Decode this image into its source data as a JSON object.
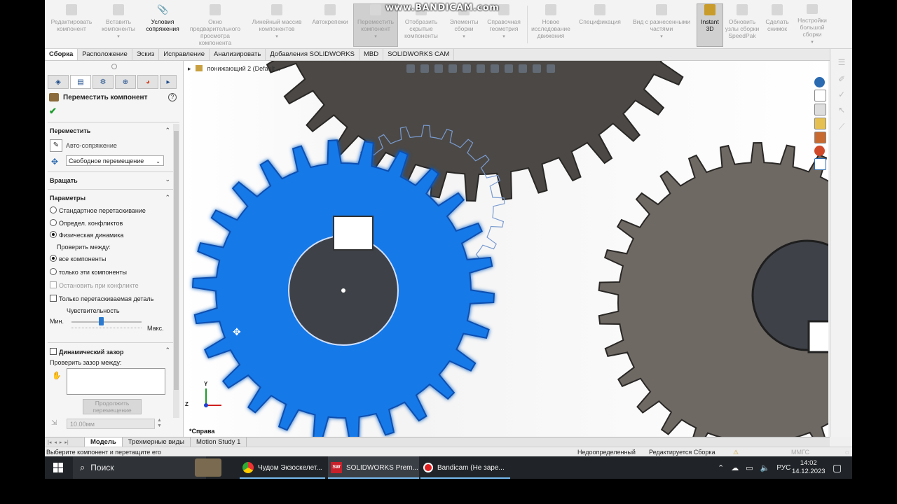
{
  "watermark": "www.BANDICAM.com",
  "ribbon": [
    {
      "id": "edit-component",
      "label": "Редактировать компонент",
      "icon": "edit-component-icon",
      "state": "disabled"
    },
    {
      "id": "insert-components",
      "label": "Вставить компоненты",
      "icon": "insert-components-icon",
      "state": "disabled",
      "dropdown": "▾"
    },
    {
      "id": "mate",
      "label": "Условия сопряжения",
      "icon": "paperclip-icon",
      "state": "active"
    },
    {
      "id": "component-preview",
      "label": "Окно предварительного просмотра компонента",
      "icon": "preview-window-icon",
      "state": "disabled"
    },
    {
      "id": "linear-pattern",
      "label": "Линейный массив компонентов",
      "icon": "linear-pattern-icon",
      "state": "disabled",
      "dropdown": "▾"
    },
    {
      "id": "smart-fasteners",
      "label": "Автокрепежи",
      "icon": "fasteners-icon",
      "state": "disabled"
    },
    {
      "id": "move-component",
      "label": "Переместить компонент",
      "icon": "move-component-icon",
      "state": "pressed",
      "dropdown": "▾"
    },
    {
      "id": "show-hidden",
      "label": "Отобразить скрытые компоненты",
      "icon": "show-hidden-icon",
      "state": "disabled"
    },
    {
      "id": "assembly-features",
      "label": "Элементы сборки",
      "icon": "assembly-features-icon",
      "state": "disabled",
      "dropdown": "▾"
    },
    {
      "id": "reference-geometry",
      "label": "Справочная геометрия",
      "icon": "reference-geometry-icon",
      "state": "disabled",
      "dropdown": "▾"
    },
    {
      "id": "new-motion-study",
      "label": "Новое исследование движения",
      "icon": "motion-study-icon",
      "state": "disabled"
    },
    {
      "id": "specification",
      "label": "Спецификация",
      "icon": "bom-icon",
      "state": "disabled"
    },
    {
      "id": "exploded-view",
      "label": "Вид с разнесенными частями",
      "icon": "exploded-view-icon",
      "state": "disabled",
      "dropdown": "▾"
    },
    {
      "id": "instant-3d",
      "label": "Instant 3D",
      "icon": "instant3d-icon",
      "state": "dark"
    },
    {
      "id": "speedpak",
      "label": "Обновить узлы сборки SpeedPak",
      "icon": "speedpak-icon",
      "state": "disabled"
    },
    {
      "id": "snapshot",
      "label": "Сделать снимок",
      "icon": "camera-icon",
      "state": "disabled"
    },
    {
      "id": "large-assembly",
      "label": "Настройки большой сборки",
      "icon": "large-assembly-icon",
      "state": "disabled",
      "dropdown": "▾"
    }
  ],
  "command_tabs": [
    "Сборка",
    "Расположение",
    "Эскиз",
    "Исправление",
    "Анализировать",
    "Добавления SOLIDWORKS",
    "MBD",
    "SOLIDWORKS CAM"
  ],
  "pm": {
    "title": "Переместить компонент",
    "help": "?",
    "ok": "✔",
    "tab_icons": [
      "feature-manager-icon",
      "property-manager-icon",
      "configuration-manager-icon",
      "dimxpert-icon",
      "display-manager-icon"
    ],
    "move_section": "Переместить",
    "smartmates": "Авто-сопряжение",
    "move_mode": "Свободное перемещение",
    "rotate_section": "Вращать",
    "options_section": "Параметры",
    "opt_standard": "Стандартное перетаскивание",
    "opt_collision": "Определ. конфликтов",
    "opt_physics": "Физическая динамика",
    "check_between": "Проверить между:",
    "opt_all": "все компоненты",
    "opt_these": "только эти компоненты",
    "stop_at_collision": "Остановить при конфликте",
    "dragged_only": "Только перетаскиваемая деталь",
    "sensitivity": "Чувствительность",
    "sens_min": "Мин.",
    "sens_max": "Макс.",
    "sensitivity_level": 0.42,
    "dyn_clearance": "Динамический зазор",
    "check_clearance": "Проверить зазор между:",
    "resume_drag": "Продолжить перемещение",
    "clearance_value": "10.00мм"
  },
  "gfx": {
    "feature_path": "понижающий 2  (Default...",
    "view_label": "*Справа",
    "triad": {
      "y": "Y",
      "z": "Z"
    },
    "colors": {
      "blue_gear": "#1679e8",
      "dark_gear": "#4b4845",
      "mid_gear": "#6f6964",
      "hub": "#3e4148"
    }
  },
  "bottom_tabs": [
    "Модель",
    "Трехмерные виды",
    "Motion Study 1"
  ],
  "status": {
    "hint": "Выберите компонент и перетащите его",
    "state": "Недоопределенный",
    "editing": "Редактируется Сборка",
    "units": "ММГС"
  },
  "taskbar": {
    "search": "Поиск",
    "apps": [
      {
        "label": "Чудом Экзоскелет...",
        "icon": "chrome-icon"
      },
      {
        "label": "SOLIDWORKS Prem...",
        "icon": "solidworks-icon"
      },
      {
        "label": "Bandicam (Не заре...",
        "icon": "bandicam-icon"
      }
    ],
    "lang": "РУС",
    "time": "14:02",
    "date": "14.12.2023"
  }
}
